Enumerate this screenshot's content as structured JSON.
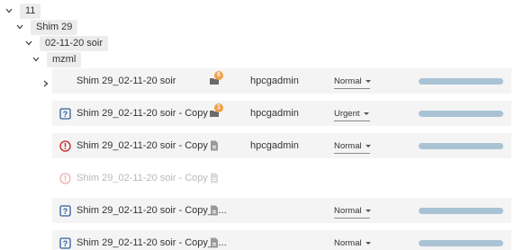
{
  "tree": {
    "level0": "11",
    "level1": "Shim 29",
    "level2": "02-11-20 soir",
    "level3": "mzml"
  },
  "colors": {
    "row_bg": "#f4f4f4",
    "progress": "#a9c3d5",
    "badge": "#f0a04b",
    "error": "#cc2222",
    "info": "#2f5f9e"
  },
  "rows": [
    {
      "name": "Shim 29_02-11-20 soir",
      "status": "none",
      "type": "folder-icon",
      "badge": "6",
      "owner": "hpcgadmin",
      "priority": "Normal",
      "progress": 1.0
    },
    {
      "name": "Shim 29_02-11-20 soir - Copy",
      "status": "question-icon",
      "type": "folder-icon",
      "badge": "1",
      "owner": "hpcgadmin",
      "priority": "Urgent",
      "progress": 1.0
    },
    {
      "name": "Shim 29_02-11-20 soir - Copy",
      "status": "error-icon",
      "type": "file-icon",
      "badge": "",
      "owner": "hpcgadmin",
      "priority": "Normal",
      "progress": 1.0
    },
    {
      "name": "Shim 29_02-11-20 soir - Copy",
      "status": "error-icon",
      "type": "file-icon",
      "badge": "",
      "owner": "",
      "priority": "",
      "progress": 0
    },
    {
      "name": "Shim 29_02-11-20 soir - Copy_c...",
      "status": "question-icon",
      "type": "file-icon",
      "badge": "",
      "owner": "",
      "priority": "Normal",
      "progress": 1.0
    },
    {
      "name": "Shim 29_02-11-20 soir - Copy_c...",
      "status": "question-icon",
      "type": "file-icon",
      "badge": "",
      "owner": "",
      "priority": "Normal",
      "progress": 1.0
    }
  ]
}
